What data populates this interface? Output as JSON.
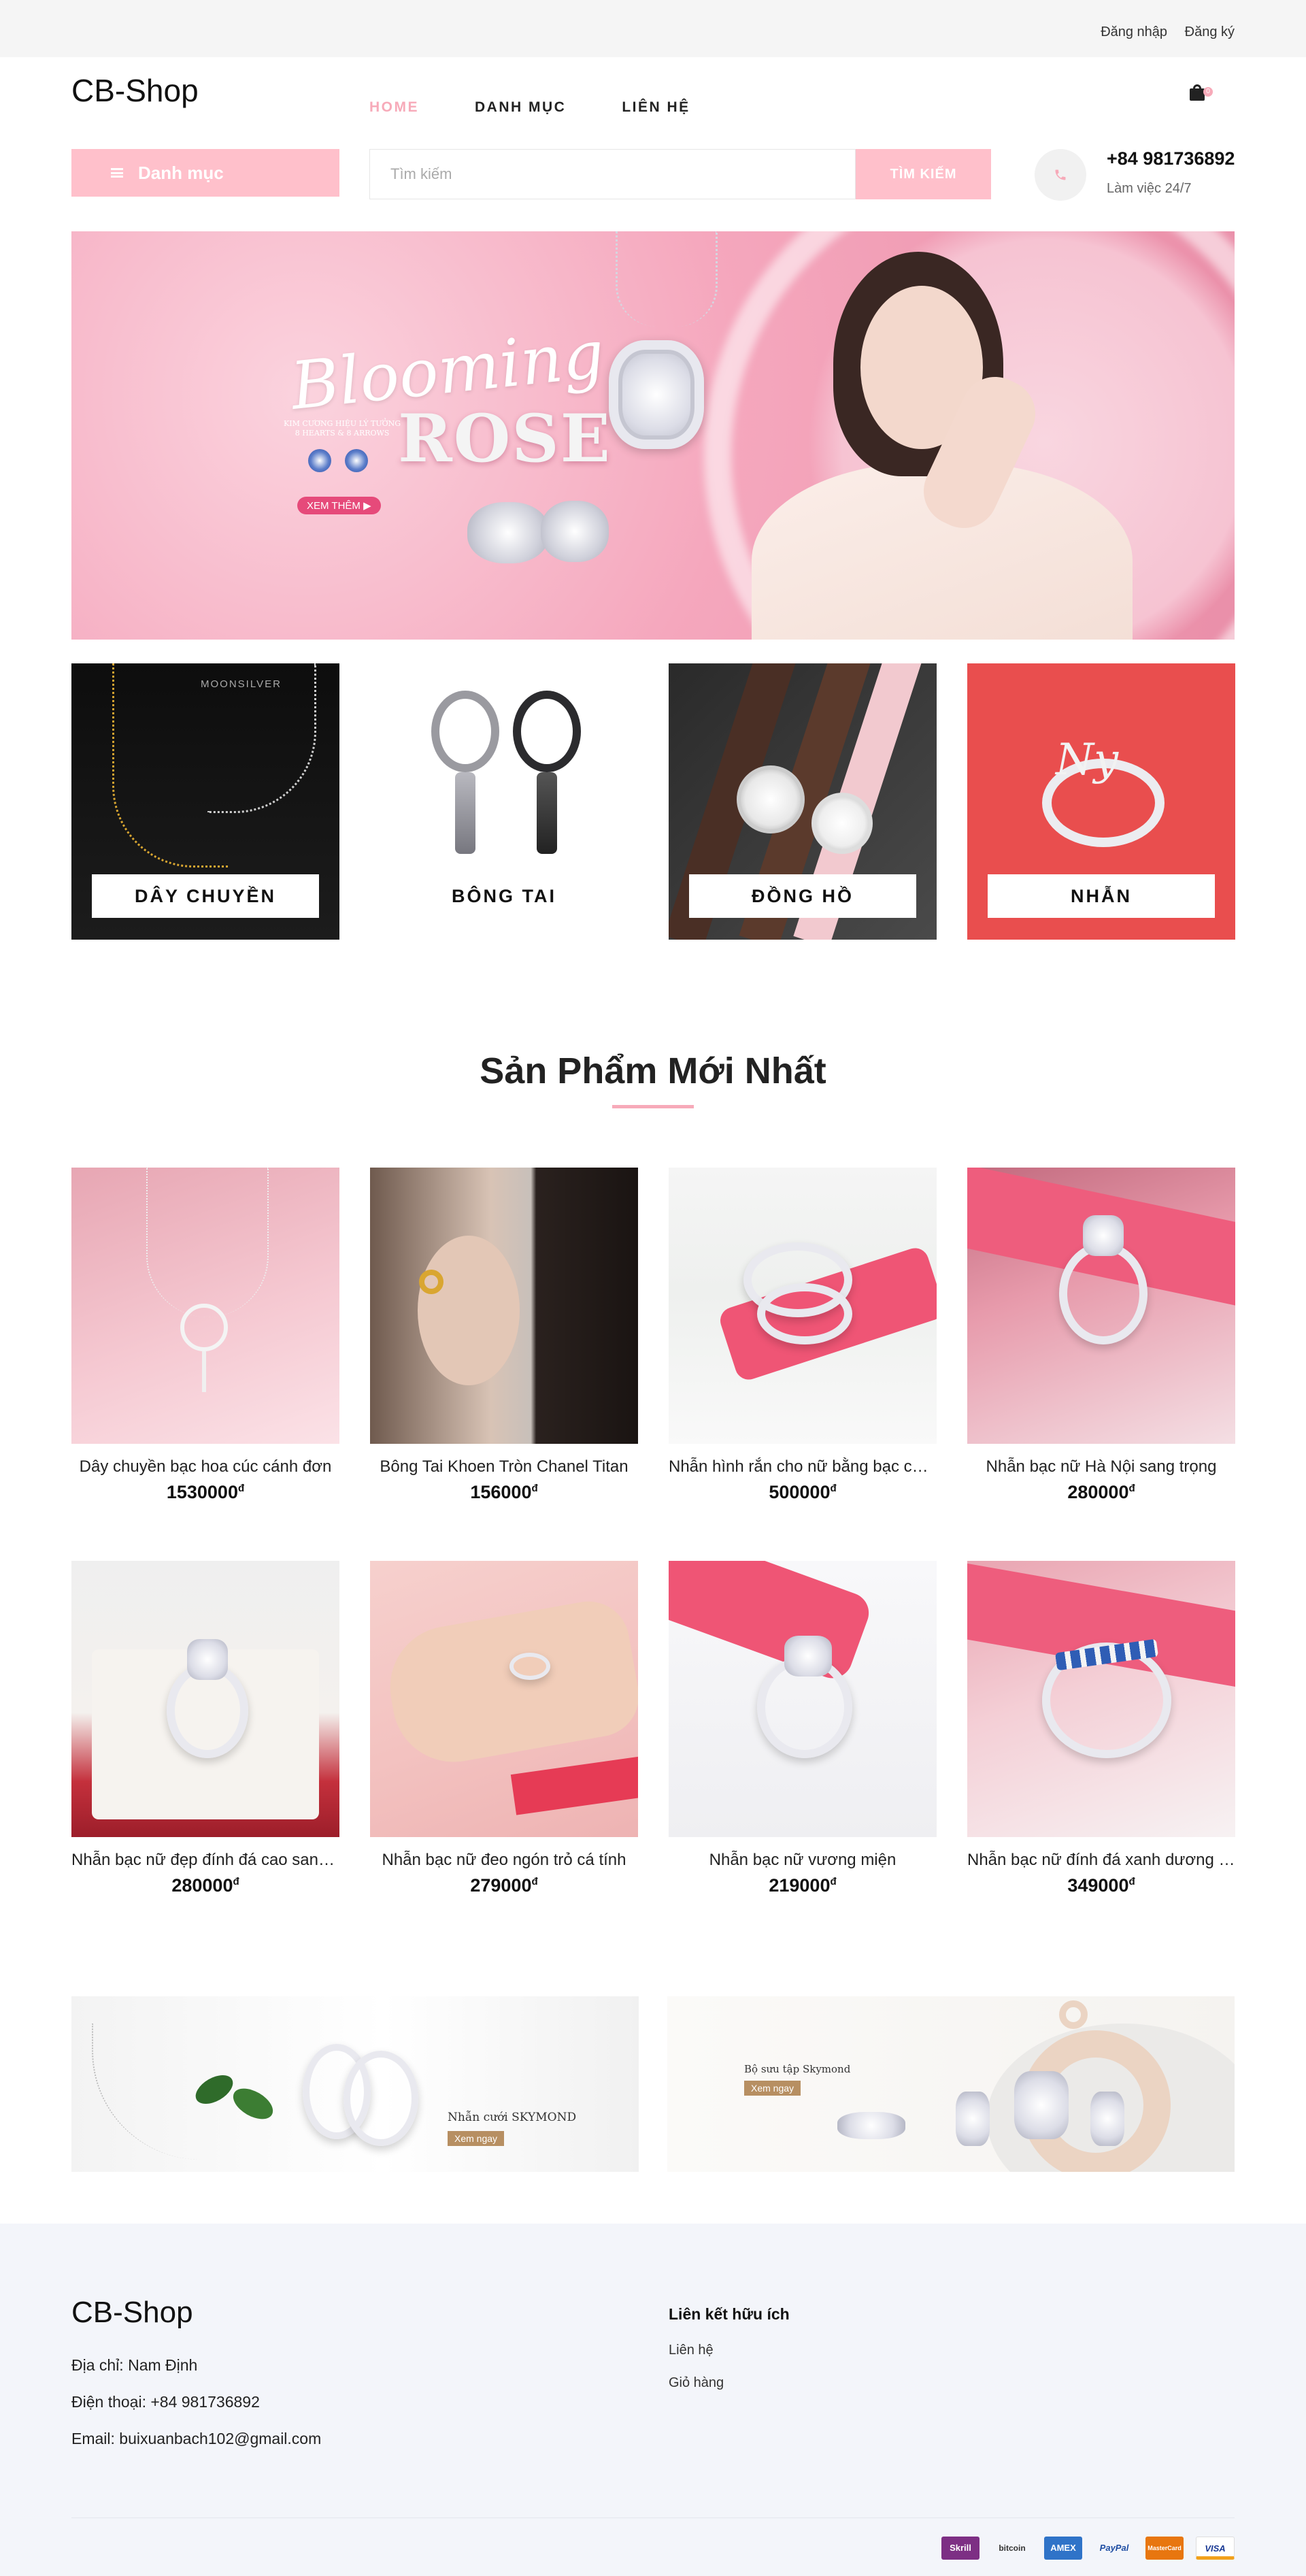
{
  "topbar": {
    "login": "Đăng nhập",
    "register": "Đăng ký"
  },
  "header": {
    "logo": "CB-Shop",
    "nav": [
      {
        "label": "HOME"
      },
      {
        "label": "DANH MỤC"
      },
      {
        "label": "LIÊN HỆ"
      }
    ],
    "cart_count": "0",
    "category_button": "Danh mục",
    "search_placeholder": "Tìm kiếm",
    "search_button": "TÌM KIẾM",
    "phone": "+84 981736892",
    "phone_sub": "Làm việc 24/7"
  },
  "banner": {
    "script": "Blooming",
    "title": "ROSE",
    "line1": "KIM CƯƠNG HIỆU LÝ TƯỞNG",
    "line2": "8 HEARTS & 8 ARROWS",
    "cta": "XEM THÊM ▶"
  },
  "categories": [
    {
      "label": "DÂY CHUYỀN",
      "brand": "MOONSILVER"
    },
    {
      "label": "BÔNG TAI"
    },
    {
      "label": "ĐỒNG HỒ"
    },
    {
      "label": "NHẪN"
    }
  ],
  "latest": {
    "title": "Sản Phẩm Mới Nhất",
    "currency": "đ",
    "products": [
      {
        "name": "Dây chuyền bạc hoa cúc cánh đơn",
        "price": "1530000"
      },
      {
        "name": "Bông Tai Khoen Tròn Chanel Titan",
        "price": "156000"
      },
      {
        "name": "Nhẫn hình rắn cho nữ bằng bạc cao cấp",
        "price": "500000"
      },
      {
        "name": "Nhẫn bạc nữ Hà Nội sang trọng",
        "price": "280000"
      },
      {
        "name": "Nhẫn bạc nữ đẹp đính đá cao sang trọng",
        "price": "280000"
      },
      {
        "name": "Nhẫn bạc nữ đeo ngón trỏ cá tính",
        "price": "279000"
      },
      {
        "name": "Nhẫn bạc nữ vương miện",
        "price": "219000"
      },
      {
        "name": "Nhẫn bạc nữ đính đá xanh dương cao cấp",
        "price": "349000"
      }
    ]
  },
  "promos": [
    {
      "title": "Nhẫn cưới SKYMOND",
      "button": "Xem ngay"
    },
    {
      "title": "Bộ sưu tập Skymond",
      "button": "Xem ngay"
    }
  ],
  "footer": {
    "logo": "CB-Shop",
    "address": "Địa chỉ: Nam Định",
    "phone": "Điện thoại: +84 981736892",
    "email": "Email: buixuanbach102@gmail.com",
    "links_title": "Liên kết hữu ích",
    "links": [
      "Liên hệ",
      "Giỏ hàng"
    ],
    "payments": [
      "Skrill",
      "bitcoin",
      "AMEX",
      "PayPal",
      "MasterCard",
      "VISA"
    ]
  },
  "colors": {
    "accent": "#ffc0cb",
    "nav_active": "#f7aab9",
    "footer_bg": "#f3f5fa"
  }
}
